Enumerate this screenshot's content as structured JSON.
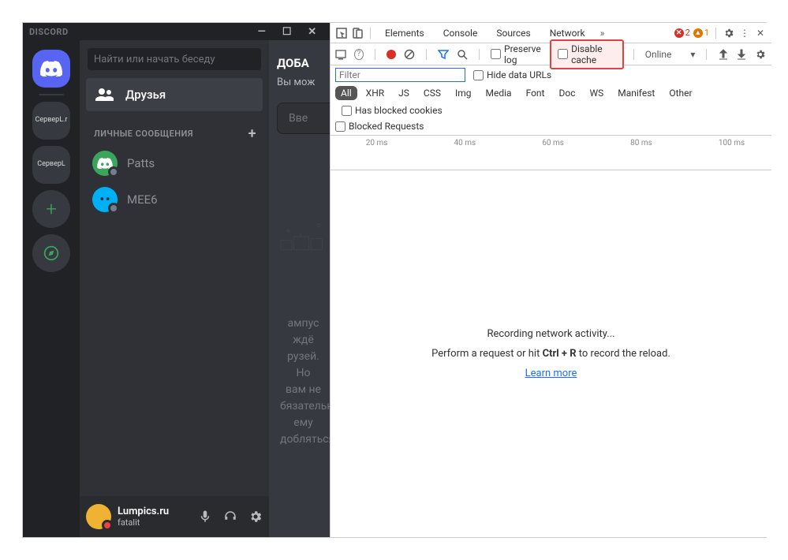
{
  "discord": {
    "title": "DISCORD",
    "search_placeholder": "Найти или начать беседу",
    "friends_label": "Друзья",
    "dm_header": "ЛИЧНЫЕ СООБЩЕНИЯ",
    "servers": [
      {
        "label": "СерверL.r"
      },
      {
        "label": "СерверL"
      }
    ],
    "dms": [
      {
        "name": "Patts"
      },
      {
        "name": "MEE6"
      }
    ],
    "user": {
      "name": "Lumpics.ru",
      "sub": "fatalit"
    },
    "content": {
      "heading": "ДОБА",
      "sub": "Вы мож",
      "input_placeholder": "Вве",
      "wumpus_text": "ампус ждё\nрузей. Но\nвам не\nбязательно\nему\nдобляться"
    }
  },
  "devtools": {
    "tabs": [
      "Elements",
      "Console",
      "Sources",
      "Network"
    ],
    "errors": "2",
    "warnings": "1",
    "toolbar": {
      "preserve_log": "Preserve log",
      "disable_cache": "Disable cache",
      "online": "Online"
    },
    "filter_placeholder": "Filter",
    "hide_urls": "Hide data URLs",
    "types": [
      "All",
      "XHR",
      "JS",
      "CSS",
      "Img",
      "Media",
      "Font",
      "Doc",
      "WS",
      "Manifest",
      "Other"
    ],
    "has_blocked": "Has blocked cookies",
    "blocked_requests": "Blocked Requests",
    "timeline_ticks": [
      "20 ms",
      "40 ms",
      "60 ms",
      "80 ms",
      "100 ms"
    ],
    "body": {
      "msg1": "Recording network activity...",
      "msg2_pre": "Perform a request or hit ",
      "msg2_key": "Ctrl + R",
      "msg2_post": " to record the reload.",
      "link": "Learn more"
    }
  }
}
